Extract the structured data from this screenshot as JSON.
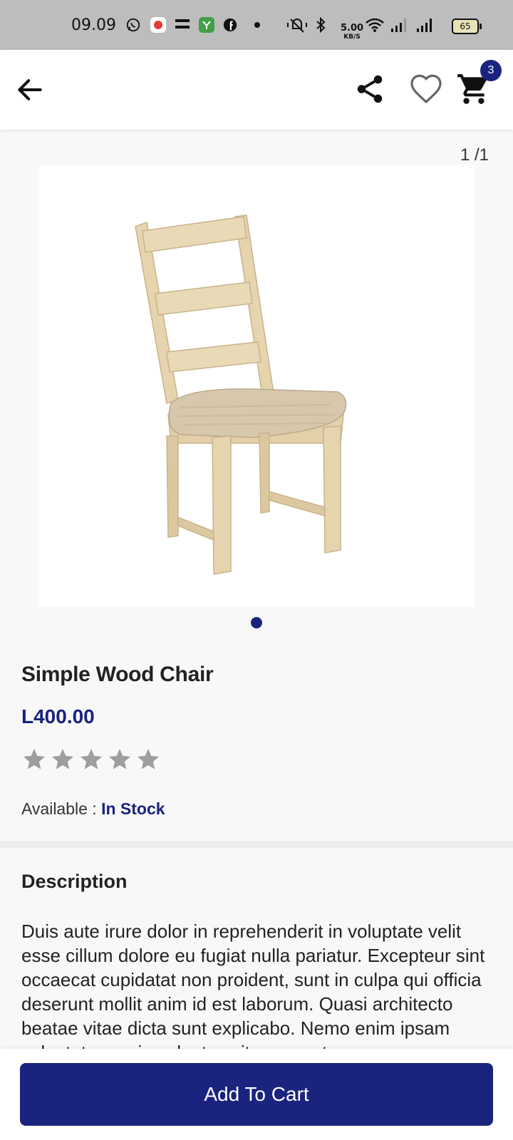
{
  "status_bar": {
    "time": "09.09",
    "speed_value": "5.00",
    "speed_unit": "KB/S",
    "battery": "65",
    "icons": [
      "whatsapp-icon",
      "app-red-icon",
      "temu-icon",
      "green-app-icon",
      "facebook-icon",
      "dot-icon",
      "mute-icon",
      "bluetooth-icon",
      "wifi-icon",
      "signal-icon",
      "signal-icon",
      "battery-icon"
    ]
  },
  "app_bar": {
    "icons": [
      "back-arrow-icon",
      "share-icon",
      "heart-icon",
      "cart-icon"
    ],
    "cart_count": "3"
  },
  "gallery": {
    "counter": "1 /1",
    "active_index": 0,
    "image": "wooden-ladder-back-chair"
  },
  "product": {
    "title": "Simple Wood Chair",
    "price": "L400.00",
    "rating": 0,
    "rating_max": 5,
    "availability_label": "Available : ",
    "availability_value": "In Stock"
  },
  "description": {
    "heading": "Description",
    "body": "Duis aute irure dolor in reprehenderit in voluptate velit esse cillum dolore eu fugiat nulla pariatur. Excepteur sint occaecat cupidatat non proident, sunt in culpa qui officia deserunt mollit anim id est laborum. Quasi architecto beatae vitae dicta sunt explicabo. Nemo enim ipsam voluptatem quia voluptas sit aspernatur"
  },
  "actions": {
    "add_to_cart": "Add To Cart"
  },
  "colors": {
    "primary": "#1a237e",
    "star_empty": "#9e9e9e",
    "chair_wood": "#e8d7b4",
    "status_bar": "#bdbdbd"
  }
}
